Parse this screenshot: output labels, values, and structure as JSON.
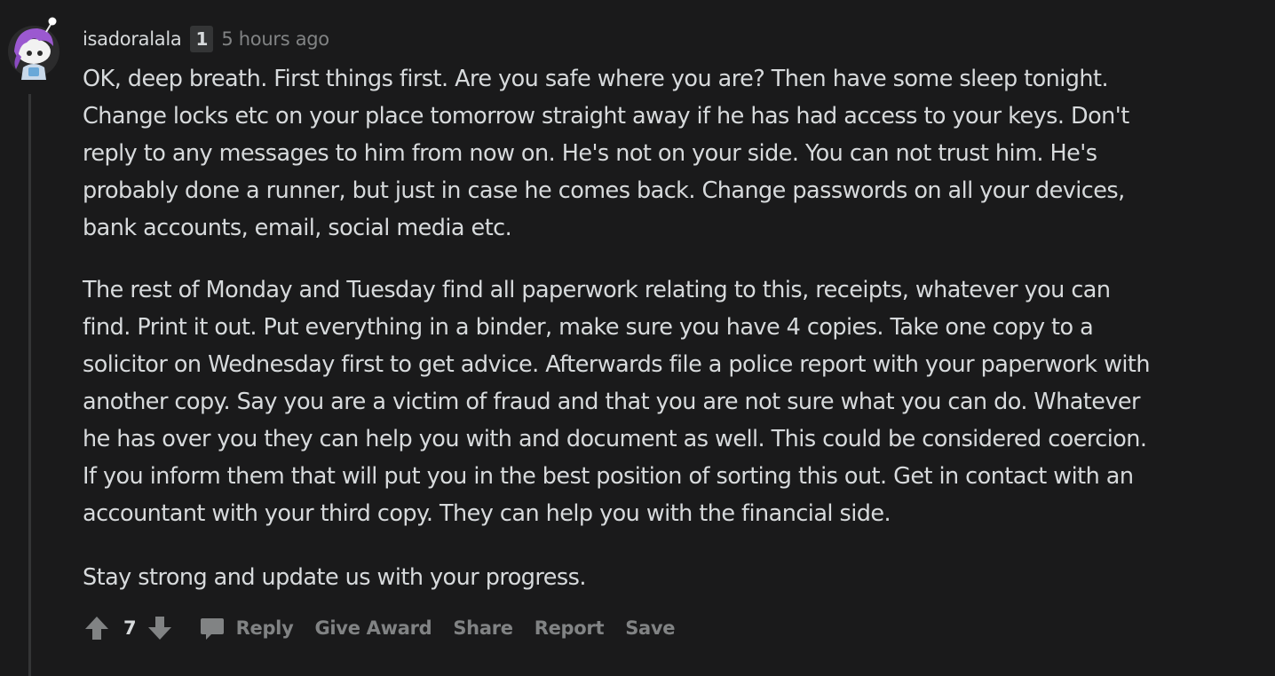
{
  "comment": {
    "author": "isadoralala",
    "flair": "1",
    "time": "5 hours ago",
    "paragraphs": [
      [
        "OK, deep breath. First things first. Are you safe where you are? Then have some sleep tonight.",
        "Change locks etc on your place tomorrow straight away if he has had access to your keys. Don't",
        "reply to any messages to him from now on. He's not on your side. You can not trust him. He's",
        "probably done a runner, but just in case he comes back. Change passwords on all your devices,",
        "bank accounts, email, social media etc."
      ],
      [
        "The rest of Monday and Tuesday find all paperwork relating to this, receipts, whatever you can",
        "find. Print it out. Put everything in a binder, make sure you have 4 copies. Take one copy to a",
        "solicitor on Wednesday first to get advice. Afterwards file a police report with your paperwork with",
        "another copy. Say you are a victim of fraud and that you are not sure what you can do. Whatever",
        "he has over you they can help you with and document as well. This could be considered coercion.",
        "If you inform them that will put you in the best position of sorting this out. Get in contact with an",
        "accountant with your third copy. They can help you with the financial side."
      ],
      [
        "Stay strong and update us with your progress."
      ]
    ],
    "score": "7"
  },
  "actions": {
    "reply": "Reply",
    "give_award": "Give Award",
    "share": "Share",
    "report": "Report",
    "save": "Save"
  },
  "icons": {
    "upvote": "arrow-up-icon",
    "downvote": "arrow-down-icon",
    "reply": "speech-bubble-icon"
  },
  "colors": {
    "background": "#1a1a1b",
    "text": "#d7dadc",
    "muted": "#818384",
    "thread_line": "#343536",
    "avatar_hair": "#9b59d0"
  }
}
